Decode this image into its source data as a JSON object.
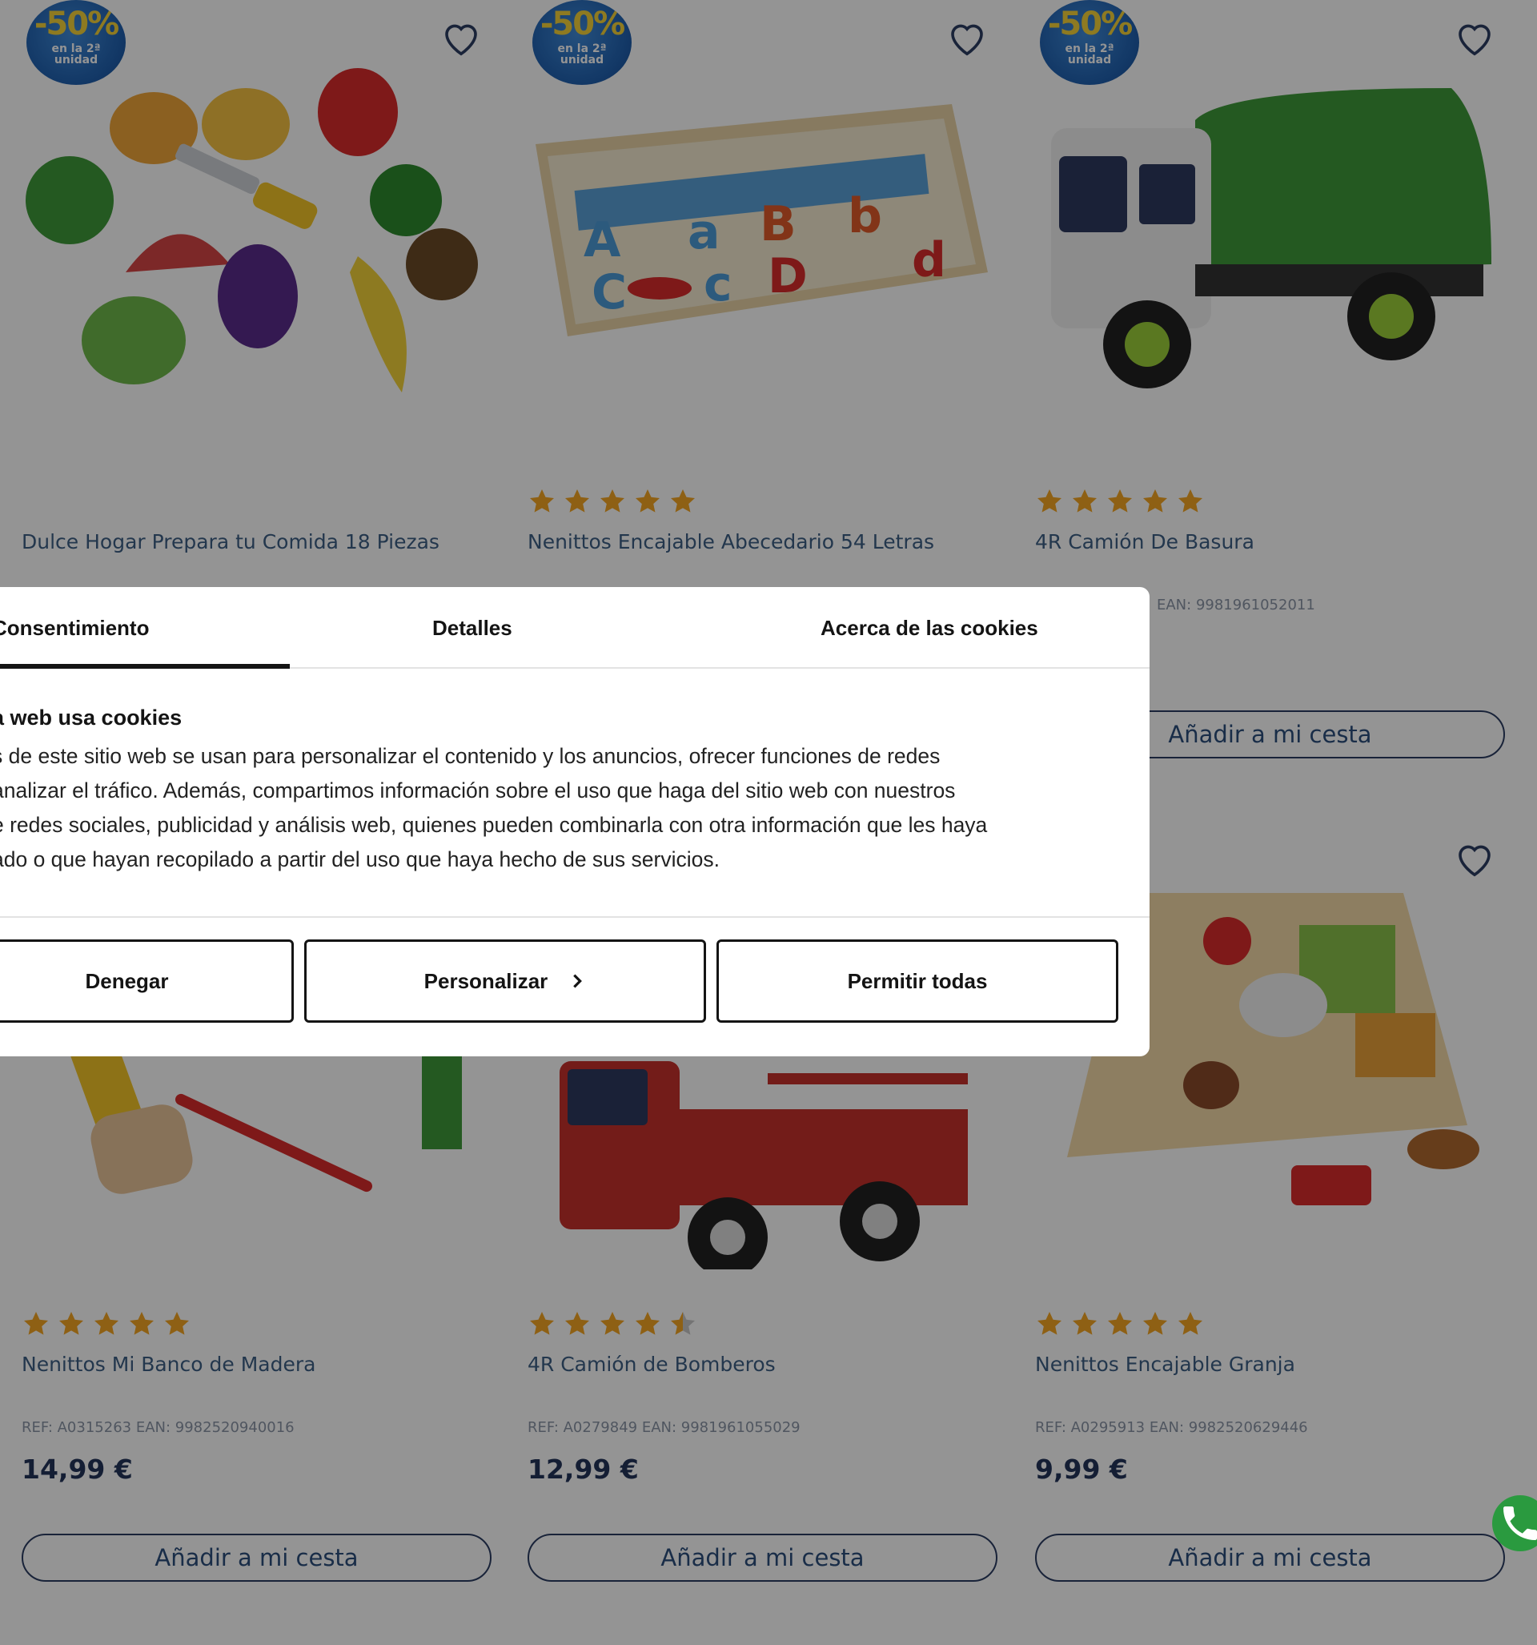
{
  "promo": {
    "percent": "-50%",
    "line1": "en la 2ª",
    "line2": "unidad"
  },
  "products": [
    {
      "name": "Dulce Hogar Prepara tu Comida 18 Piezas",
      "has_badge": true,
      "has_stars": false
    },
    {
      "name": "Nenittos Encajable Abecedario 54 Letras",
      "has_badge": true,
      "has_stars": true
    },
    {
      "name": "4R Camión De Basura",
      "ref_partial": "EAN: 9981961052011",
      "has_badge": true,
      "has_stars": true,
      "button": "Añadir a mi cesta"
    },
    {
      "name": "Nenittos Mi Banco de Madera",
      "ref": "REF: A0315263 EAN: 9982520940016",
      "price": "14,99 €",
      "button": "Añadir a mi cesta",
      "has_stars": true
    },
    {
      "name": "4R Camión de Bomberos",
      "ref": "REF: A0279849 EAN: 9981961055029",
      "price": "12,99 €",
      "button": "Añadir a mi cesta",
      "has_stars": true,
      "rating": 4.5
    },
    {
      "name": "Nenittos Encajable Granja",
      "ref": "REF: A0295913 EAN: 9982520629446",
      "price": "9,99 €",
      "button": "Añadir a mi cesta",
      "has_stars": true
    }
  ],
  "cookie_dialog": {
    "tabs": [
      "Consentimiento",
      "Detalles",
      "Acerca de las cookies"
    ],
    "active_tab": "Consentimiento",
    "heading": "a web usa cookies",
    "body_lines": [
      "s de este sitio web se usan para personalizar el contenido y los anuncios, ofrecer funciones de redes",
      "analizar el tráfico. Además, compartimos información sobre el uso que haga del sitio web con nuestros",
      "e redes sociales, publicidad y análisis web, quienes pueden combinarla con otra información que les haya",
      "ado o que hayan recopilado a partir del uso que haya hecho de sus servicios."
    ],
    "buttons": {
      "deny": "Denegar",
      "customize": "Personalizar",
      "allow_all": "Permitir todas"
    }
  },
  "colors": {
    "overlay": "rgba(0,0,0,0.42)",
    "star": "#f5a623",
    "whatsapp": "#2a9a3f",
    "button_border": "#2b3d62"
  }
}
